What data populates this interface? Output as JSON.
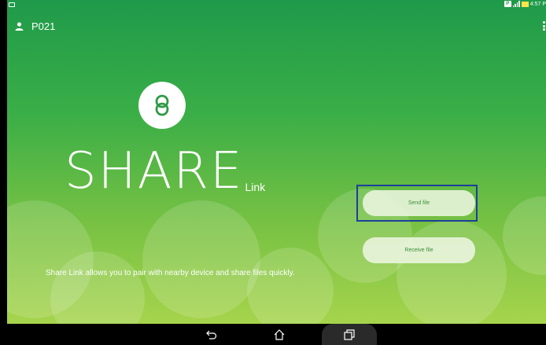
{
  "status_bar": {
    "time": "4:57 P",
    "notification_badge": "P"
  },
  "top_bar": {
    "user_label": "P021"
  },
  "brand": {
    "main": "SHARE",
    "suffix": "Link"
  },
  "actions": {
    "send_label": "Send file",
    "receive_label": "Receive file"
  },
  "description": "Share Link allows you to pair with nearby device and share files quickly.",
  "colors": {
    "accent_dark": "#1f9a4a",
    "accent_light": "#a6d44c",
    "highlight_border": "#1d3f9a"
  },
  "icons": {
    "status_left": "screenshot-icon",
    "user": "person-icon",
    "menu": "overflow-menu-icon",
    "logo": "sharelink-logo-icon",
    "nav_back": "back-icon",
    "nav_home": "home-icon",
    "nav_recent": "recent-apps-icon"
  }
}
